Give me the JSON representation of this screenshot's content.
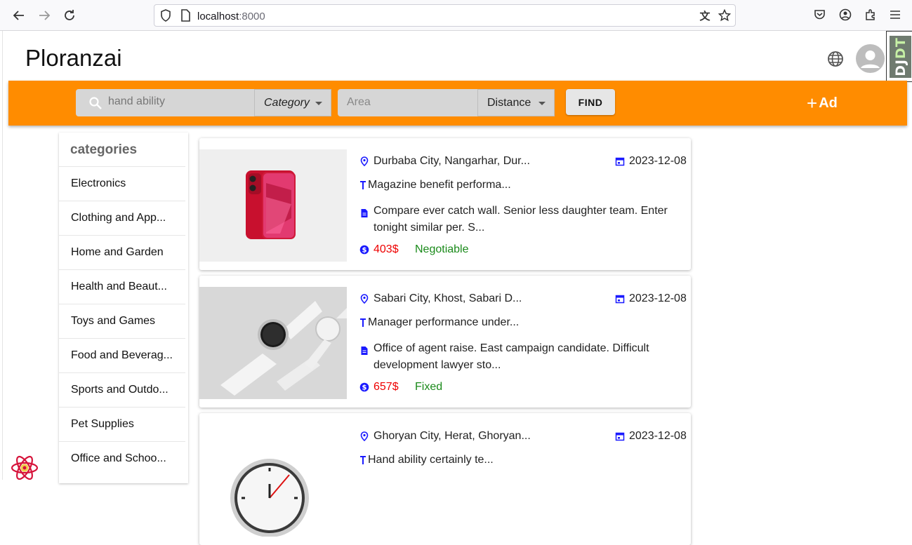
{
  "browser": {
    "url_host": "localhost",
    "url_port": ":8000"
  },
  "header": {
    "brand": "Ploranzai",
    "djdt_label_a": "DJ",
    "djdt_label_b": "DT"
  },
  "search": {
    "query": "hand ability",
    "category_label": "Category",
    "area_placeholder": "Area",
    "distance_label": "Distance",
    "find_label": "FIND",
    "ad_label": "Ad"
  },
  "sidebar": {
    "title": "categories",
    "items": [
      {
        "label": "Electronics"
      },
      {
        "label": "Clothing and App..."
      },
      {
        "label": "Home and Garden"
      },
      {
        "label": "Health and Beaut..."
      },
      {
        "label": "Toys and Games"
      },
      {
        "label": "Food and Beverag..."
      },
      {
        "label": "Sports and Outdo..."
      },
      {
        "label": "Pet Supplies"
      },
      {
        "label": "Office and Schoo..."
      }
    ]
  },
  "listings": [
    {
      "location": "Durbaba City, Nangarhar, Dur...",
      "date": "2023-12-08",
      "title": "Magazine benefit performa...",
      "description": "Compare ever catch wall. Senior less daughter team. Enter tonight similar per. S...",
      "price": "403$",
      "price_type": "Negotiable",
      "image": "phone"
    },
    {
      "location": "Sabari City, Khost, Sabari D...",
      "date": "2023-12-08",
      "title": "Manager performance under...",
      "description": "Office of agent raise. East campaign candidate. Difficult development lawyer sto...",
      "price": "657$",
      "price_type": "Fixed",
      "image": "watch"
    },
    {
      "location": "Ghoryan City, Herat, Ghoryan...",
      "date": "2023-12-08",
      "title": "Hand ability certainly te...",
      "description": "",
      "price": "",
      "price_type": "",
      "image": "clock"
    }
  ],
  "colors": {
    "accent": "#ff8c00",
    "icon_blue": "#1a1aff",
    "price_red": "#e00000",
    "status_green": "#1a8a1a"
  }
}
